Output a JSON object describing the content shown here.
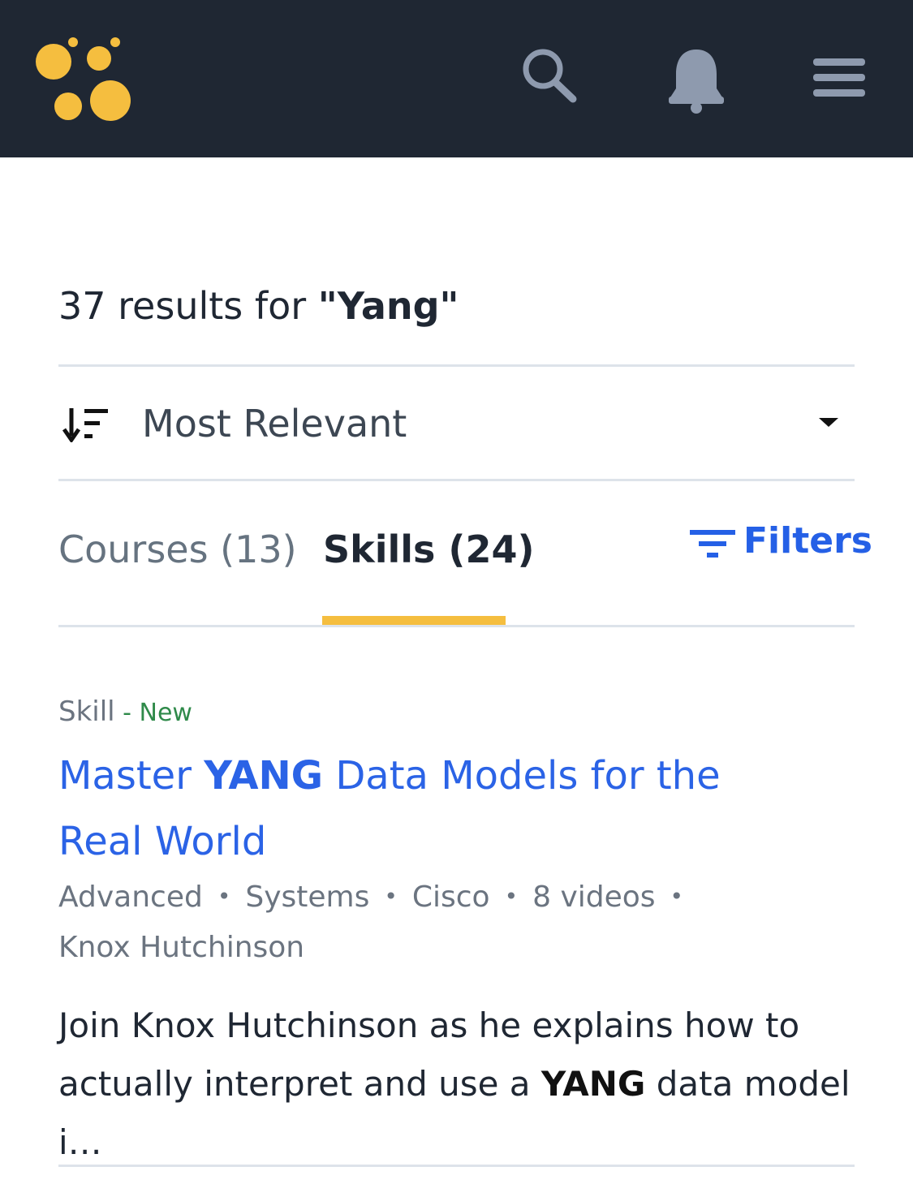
{
  "topbar": {
    "logo_icon": "dots-logo-icon",
    "search_icon": "search-icon",
    "bell_icon": "bell-icon",
    "menu_icon": "hamburger-menu-icon",
    "accent": "#f5be3f",
    "background": "#1f2733"
  },
  "results": {
    "prefix": "37 results for ",
    "query": "\"Yang\""
  },
  "sort": {
    "icon": "sort-descending-icon",
    "label": "Most Relevant",
    "caret_icon": "caret-down-icon"
  },
  "tabs": [
    {
      "label": "Courses (13)",
      "active": false
    },
    {
      "label": "Skills (24)",
      "active": true
    }
  ],
  "filters": {
    "icon": "filter-icon",
    "label": "Filters",
    "color": "#2560e6"
  },
  "card": {
    "type": "Skill",
    "badge": " - New",
    "title_before": "Master ",
    "title_highlight": "YANG",
    "title_after": " Data Models for the Real World",
    "meta": [
      "Advanced",
      "Systems",
      "Cisco",
      "8 videos",
      "Knox Hutchinson"
    ],
    "meta_separator": "•",
    "desc_before": "Join Knox Hutchinson as he explains how to actually interpret and use a ",
    "desc_highlight": "YANG",
    "desc_after": " data model i…"
  }
}
